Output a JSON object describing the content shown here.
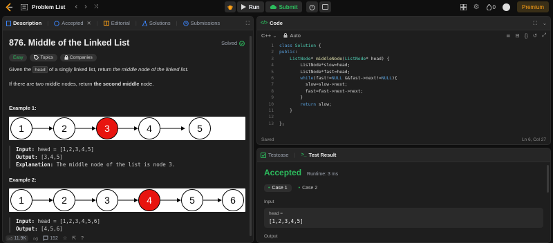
{
  "header": {
    "problem_list": "Problem List",
    "run": "Run",
    "submit": "Submit",
    "streak": "0",
    "premium": "Premium"
  },
  "left": {
    "tabs": [
      "Description",
      "Accepted",
      "Editorial",
      "Solutions",
      "Submissions"
    ],
    "title": "876. Middle of the Linked List",
    "solved": "Solved",
    "pills": [
      "Easy",
      "Topics",
      "Companies"
    ],
    "p1": {
      "pre": "Given the ",
      "code": "head",
      "mid": " of a singly linked list, return ",
      "em": "the middle node of the linked list",
      "post": "."
    },
    "p2": {
      "pre": "If there are two middle nodes, return ",
      "bold": "the second middle",
      "post": " node."
    },
    "ex1": {
      "heading": "Example 1:",
      "nodes": [
        "1",
        "2",
        "3",
        "4",
        "5"
      ],
      "input_label": "Input:",
      "input": "head = [1,2,3,4,5]",
      "output_label": "Output:",
      "output": "[3,4,5]",
      "expl_label": "Explanation:",
      "expl": "The middle node of the list is node 3."
    },
    "ex2": {
      "heading": "Example 2:",
      "nodes": [
        "1",
        "2",
        "3",
        "4",
        "5",
        "6"
      ],
      "input_label": "Input:",
      "input": "head = [1,2,3,4,5,6]",
      "output_label": "Output:",
      "output": "[4,5,6]"
    },
    "footer": {
      "likes": "11.9K",
      "comments": "152"
    }
  },
  "code": {
    "title": "Code",
    "lang": "C++",
    "auto": "Auto",
    "saved": "Saved",
    "cursor": "Ln 6, Col 27",
    "line_numbers": [
      "1",
      "2",
      "3",
      "4",
      "5",
      "6",
      "7",
      "8",
      "9",
      "10",
      "11",
      "12",
      "13"
    ]
  },
  "result": {
    "tab_testcase": "Testcase",
    "tab_result": "Test Result",
    "status": "Accepted",
    "runtime": "Runtime: 3 ms",
    "case1": "Case 1",
    "case2": "Case 2",
    "input_label": "Input",
    "var": "head =",
    "value": "[1,2,3,4,5]",
    "output_label": "Output"
  }
}
